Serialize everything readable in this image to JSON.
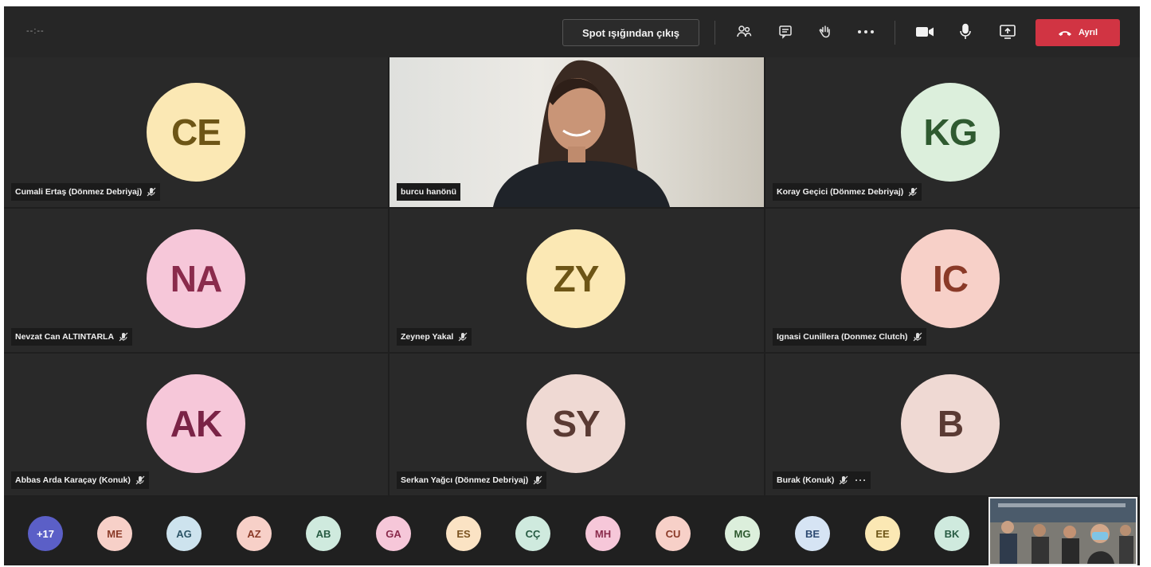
{
  "toolbar": {
    "timer": "--:--",
    "spotlight_button": "Spot ışığından çıkış",
    "leave_button": "Ayrıl",
    "icons": [
      "participants-icon",
      "chat-icon",
      "raise-hand-icon",
      "more-icon",
      "camera-icon",
      "microphone-icon",
      "share-screen-icon"
    ]
  },
  "video_participant": {
    "name": "burcu hanönü"
  },
  "participants": [
    {
      "initials": "CE",
      "name": "Cumali Ertaş (Dönmez Debriyaj)",
      "bg": "#fbe8b4",
      "fg": "#6d5516"
    },
    {
      "initials": "KG",
      "name": "Koray Geçici (Dönmez Debriyaj)",
      "bg": "#dcefdc",
      "fg": "#2f5a30"
    },
    {
      "initials": "NA",
      "name": "Nevzat Can ALTINTARLA",
      "bg": "#f6c7d9",
      "fg": "#8a2b4c"
    },
    {
      "initials": "ZY",
      "name": "Zeynep Yakal",
      "bg": "#fbe8b4",
      "fg": "#6d5516"
    },
    {
      "initials": "IC",
      "name": "Ignasi Cunillera (Donmez Clutch)",
      "bg": "#f7d0c8",
      "fg": "#8a3a28"
    },
    {
      "initials": "AK",
      "name": "Abbas Arda Karaçay (Konuk)",
      "bg": "#f6c7d9",
      "fg": "#7a2346"
    },
    {
      "initials": "SY",
      "name": "Serkan Yağcı (Dönmez Debriyaj)",
      "bg": "#efd9d3",
      "fg": "#5a3a33"
    },
    {
      "initials": "B",
      "name": "Burak (Konuk)",
      "bg": "#efd9d3",
      "fg": "#5a3a33",
      "more": "···"
    }
  ],
  "strip": {
    "overflow": "+17",
    "overflow_bg": "#5b5fc7",
    "avatars": [
      {
        "initials": "ME",
        "bg": "#f7d0c8",
        "fg": "#8a3a28"
      },
      {
        "initials": "AG",
        "bg": "#cde3ee",
        "fg": "#2c5466"
      },
      {
        "initials": "AZ",
        "bg": "#f7d0c8",
        "fg": "#8a3a28"
      },
      {
        "initials": "AB",
        "bg": "#cfeade",
        "fg": "#275b43"
      },
      {
        "initials": "GA",
        "bg": "#f6c7d9",
        "fg": "#8a2b4c"
      },
      {
        "initials": "ES",
        "bg": "#fbe3c4",
        "fg": "#7a5220"
      },
      {
        "initials": "CÇ",
        "bg": "#cfeade",
        "fg": "#275b43"
      },
      {
        "initials": "MH",
        "bg": "#f6c7d9",
        "fg": "#8a2b4c"
      },
      {
        "initials": "CU",
        "bg": "#f7d0c8",
        "fg": "#8a3a28"
      },
      {
        "initials": "MG",
        "bg": "#dcefdc",
        "fg": "#2f5a30"
      },
      {
        "initials": "BE",
        "bg": "#d6e4f4",
        "fg": "#2d4a72"
      },
      {
        "initials": "EE",
        "bg": "#fbe8b4",
        "fg": "#6d5516"
      },
      {
        "initials": "BK",
        "bg": "#cfeade",
        "fg": "#275b43"
      }
    ]
  }
}
